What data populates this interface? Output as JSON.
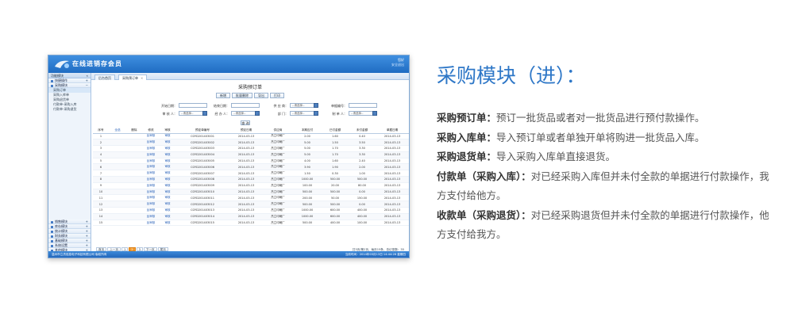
{
  "app": {
    "title": "在线进销存会员",
    "user_line1": "您好",
    "user_line2": "安全退出",
    "colors": {
      "titlebar": "#2a7ad2",
      "accent": "#2e77c7",
      "pager_active": "#f39a2c"
    }
  },
  "sidebar": {
    "header": "功能模块",
    "top_groups": [
      {
        "label": "快捷操作",
        "mark": "+"
      },
      {
        "label": "采购模块",
        "mark": "−"
      }
    ],
    "items": [
      "采购订单",
      "采购入库单",
      "采购退货单",
      "付款单-采购入库",
      "付款单-采购退货"
    ],
    "bottom_groups": [
      "销售模块",
      "库存模块",
      "统计模块",
      "财务模块",
      "基础模块",
      "系统设置",
      "其他模块"
    ]
  },
  "tabs": [
    {
      "label": "后台首页"
    },
    {
      "label": "采购预订单"
    }
  ],
  "form": {
    "title": "采购预订单",
    "buttons": [
      "新增",
      "批量删除",
      "导出",
      "打印"
    ],
    "row1": [
      {
        "label": "开始日期：",
        "value": ""
      },
      {
        "label": "结束日期：",
        "value": ""
      },
      {
        "label": "供 应 商：",
        "value": "--请选择--"
      },
      {
        "label": "单据编号：",
        "value": ""
      }
    ],
    "row2": [
      {
        "label": "审 核 人：",
        "value": "--请选择--"
      },
      {
        "label": "经 办 人：",
        "value": "--请选择--"
      },
      {
        "label": "部 门：",
        "value": "--请选择--"
      },
      {
        "label": "制 单 人：",
        "value": "--请选择--"
      }
    ],
    "query": "查 询"
  },
  "grid": {
    "columns": [
      "序号",
      "全选",
      "删除",
      "修改",
      "审核",
      "预定单编号",
      "预定日期",
      "供应商",
      "本期应付",
      "已付金额",
      "未付金额",
      "单据日期"
    ],
    "rows": [
      [
        "1",
        "",
        "",
        "反审核",
        "审核",
        "CGYD201403001",
        "2014-03-13",
        "杰立印刷厂",
        "2.00",
        "1.60",
        "0.40",
        "2014-03-13"
      ],
      [
        "2",
        "",
        "",
        "反审核",
        "审核",
        "CGYD201403002",
        "2014-03-13",
        "杰立印刷厂",
        "5.00",
        "1.50",
        "3.50",
        "2014-03-13"
      ],
      [
        "3",
        "",
        "",
        "反审核",
        "审核",
        "CGYD201403003",
        "2014-03-13",
        "杰立印刷厂",
        "5.00",
        "1.70",
        "3.30",
        "2014-03-13"
      ],
      [
        "4",
        "",
        "",
        "反审核",
        "审核",
        "CGYD201403004",
        "2014-03-13",
        "杰立印刷厂",
        "5.00",
        "1.70",
        "3.30",
        "2014-03-13"
      ],
      [
        "5",
        "",
        "",
        "反审核",
        "审核",
        "CGYD201403005",
        "2014-03-13",
        "杰立印刷厂",
        "4.00",
        "1.60",
        "2.40",
        "2014-03-13"
      ],
      [
        "6",
        "",
        "",
        "反审核",
        "审核",
        "CGYD201403006",
        "2014-03-13",
        "杰立印刷厂",
        "3.90",
        "1.90",
        "2.00",
        "2014-03-13"
      ],
      [
        "7",
        "",
        "",
        "反审核",
        "审核",
        "CGYD201403007",
        "2014-03-13",
        "杰立印刷厂",
        "1.50",
        "0.30",
        "1.00",
        "2014-03-13"
      ],
      [
        "8",
        "",
        "",
        "反审核",
        "审核",
        "CGYD201403008",
        "2014-03-13",
        "杰立印刷厂",
        "1000.00",
        "500.00",
        "500.00",
        "2014-03-13"
      ],
      [
        "9",
        "",
        "",
        "反审核",
        "审核",
        "CGYD201403009",
        "2014-03-13",
        "杰立印刷厂",
        "100.00",
        "20.00",
        "80.00",
        "2014-03-13"
      ],
      [
        "10",
        "",
        "",
        "反审核",
        "审核",
        "CGYD201403010",
        "2014-03-13",
        "杰立印刷厂",
        "500.00",
        "500.00",
        "0.00",
        "2014-03-13"
      ],
      [
        "11",
        "",
        "",
        "反审核",
        "审核",
        "CGYD201403011",
        "2014-03-13",
        "杰立印刷厂",
        "200.00",
        "50.00",
        "150.00",
        "2014-03-13"
      ],
      [
        "12",
        "",
        "",
        "反审核",
        "审核",
        "CGYD201403012",
        "2014-03-13",
        "杰立印刷厂",
        "500.00",
        "500.00",
        "0.00",
        "2014-03-13"
      ],
      [
        "13",
        "",
        "",
        "反审核",
        "审核",
        "CGYD201403013",
        "2014-03-13",
        "杰立印刷厂",
        "1000.00",
        "600.00",
        "400.00",
        "2014-03-13"
      ],
      [
        "14",
        "",
        "",
        "反审核",
        "审核",
        "CGYD201403014",
        "2014-03-13",
        "杰立印刷厂",
        "1000.00",
        "600.00",
        "400.00",
        "2014-03-13"
      ],
      [
        "15",
        "",
        "",
        "反审核",
        "审核",
        "CGYD201403015",
        "2014-03-13",
        "杰立印刷厂",
        "500.00",
        "400.00",
        "100.00",
        "2014-03-13"
      ]
    ]
  },
  "pager": {
    "buttons": [
      "首页",
      "上一页",
      "1",
      "2",
      "3",
      "下一页",
      "尾页"
    ],
    "active": "2",
    "info": "共3页/第2页，每页15条，总记录数：35"
  },
  "status": {
    "left": "温州市立杰信息电子科技有限公司 版权所有",
    "right": "当前时间：2014年03月13日 14:44:26 星期四"
  },
  "panel": {
    "heading": "采购模块（进）：",
    "items": [
      {
        "term": "采购预订单：",
        "text": "预订一批货品或者对一批货品进行预付款操作。"
      },
      {
        "term": "采购入库单：",
        "text": "导入预订单或者单独开单将购进一批货品入库。"
      },
      {
        "term": "采购退货单：",
        "text": "导入采购入库单直接退货。"
      },
      {
        "term": "付款单（采购入库）：",
        "text": "对已经采购入库但并未付全款的单据进行付款操作，我方支付给他方。"
      },
      {
        "term": "收款单（采购退货）：",
        "text": "对已经采购退货但并未付全款的单据进行付款操作，他方支付给我方。"
      }
    ]
  }
}
